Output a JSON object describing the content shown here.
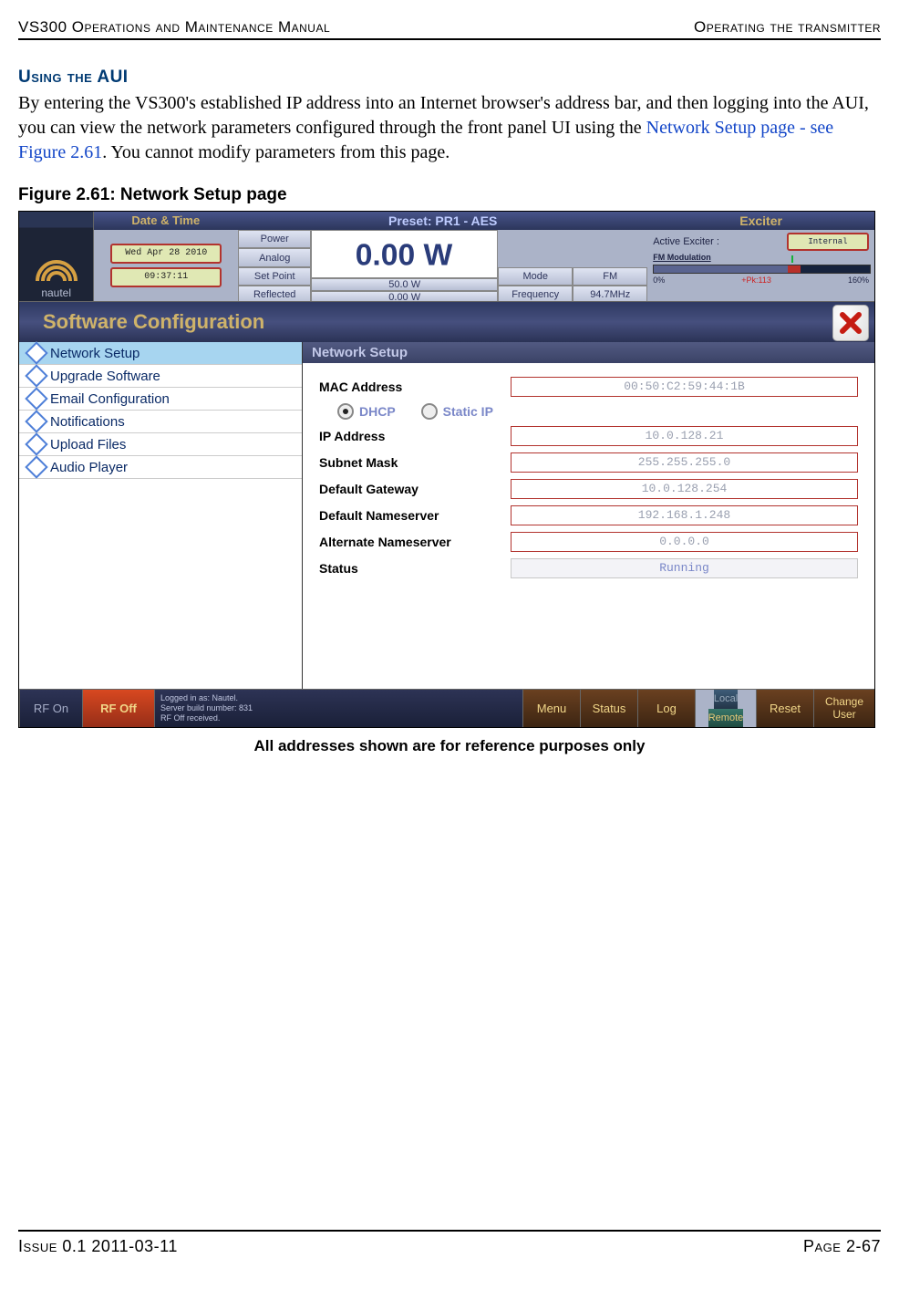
{
  "header": {
    "left": "VS300 Operations and Maintenance Manual",
    "right": "Operating the transmitter"
  },
  "section": {
    "title": "Using the AUI",
    "text_pre": "By entering the VS300's established IP address into an Internet browser's address bar, and then logging into the AUI, you can view the network parameters configured through the front panel UI using the ",
    "link": "Network Setup page - see Figure 2.61",
    "text_post": ". You cannot modify parameters from this page."
  },
  "figure": {
    "caption": "Figure 2.61: Network Setup page",
    "note": "All addresses shown are for reference purposes only"
  },
  "app": {
    "logo": "nautel",
    "datetime": {
      "title": "Date & Time",
      "date": "Wed Apr 28 2010",
      "time": "09:37:11"
    },
    "preset": {
      "title": "Preset: PR1 - AES",
      "gauges": {
        "power": "Power",
        "analog": "Analog",
        "setpoint": "Set Point",
        "reflected": "Reflected"
      },
      "big": "0.00 W",
      "setpoint_val": "50.0 W",
      "mode_label": "Mode",
      "mode_val": "FM",
      "reflected_val": "0.00 W",
      "freq_label": "Frequency",
      "freq_val": "94.7MHz"
    },
    "exciter": {
      "title": "Exciter",
      "active_label": "Active Exciter :",
      "active_val": "Internal",
      "mod_label": "FM Modulation",
      "scale_low": "0%",
      "pk": "+Pk:113",
      "scale_high": "160%"
    },
    "panel_title": "Software Configuration",
    "sidebar": [
      "Network Setup",
      "Upgrade Software",
      "Email Configuration",
      "Notifications",
      "Upload Files",
      "Audio Player"
    ],
    "content": {
      "title": "Network Setup",
      "rows": {
        "mac_label": "MAC Address",
        "mac": "00:50:C2:59:44:1B",
        "dhcp": "DHCP",
        "static": "Static IP",
        "ip_label": "IP Address",
        "ip": "10.0.128.21",
        "subnet_label": "Subnet Mask",
        "subnet": "255.255.255.0",
        "gw_label": "Default Gateway",
        "gw": "10.0.128.254",
        "ns_label": "Default Nameserver",
        "ns": "192.168.1.248",
        "alt_label": "Alternate Nameserver",
        "alt": "0.0.0.0",
        "status_label": "Status",
        "status": "Running"
      }
    },
    "bottom": {
      "rf_on": "RF On",
      "rf_off": "RF Off",
      "info1": "Logged in as:    Nautel.",
      "info2": "Server build number: 831",
      "info3": "RF Off received.",
      "menu": "Menu",
      "status": "Status",
      "log": "Log",
      "local": "Local",
      "remote": "Remote",
      "reset": "Reset",
      "change1": "Change",
      "change2": "User"
    }
  },
  "footer": {
    "left": "Issue 0.1  2011-03-11",
    "right": "Page 2-67"
  }
}
